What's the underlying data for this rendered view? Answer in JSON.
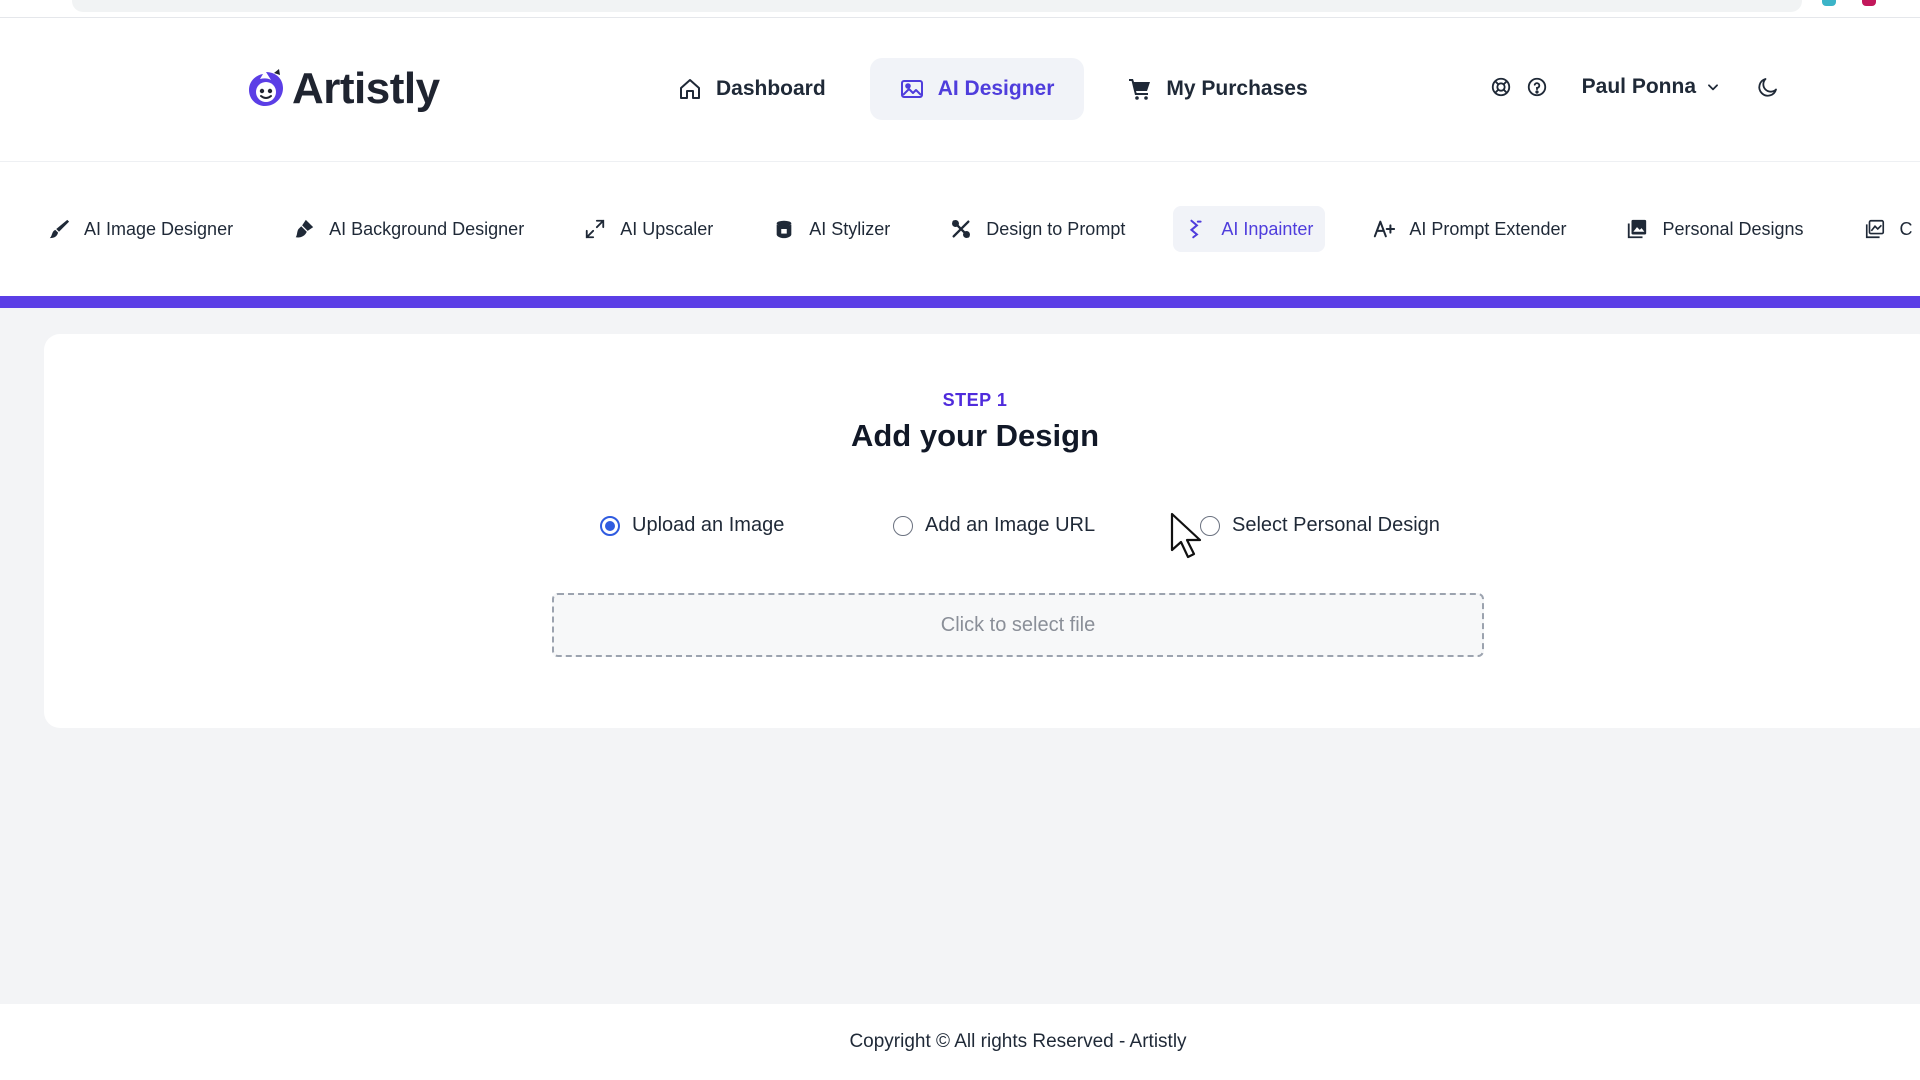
{
  "brand": {
    "name": "Artistly",
    "accent_color": "#5b3ee6",
    "active_text_color": "#4f3ddc",
    "logo_icon": "palette-face-icon"
  },
  "main_nav": [
    {
      "label": "Dashboard",
      "icon": "home-icon",
      "active": false
    },
    {
      "label": "AI Designer",
      "icon": "image-icon",
      "active": true
    },
    {
      "label": "My Purchases",
      "icon": "cart-icon",
      "active": false
    }
  ],
  "header": {
    "support_icon": "lifebuoy-icon",
    "help_icon": "question-icon",
    "user_name": "Paul Ponna",
    "theme_icon": "moon-icon"
  },
  "sub_nav": [
    {
      "label": "AI Image Designer",
      "icon": "brush-icon",
      "active": false
    },
    {
      "label": "AI Background Designer",
      "icon": "paint-drop-icon",
      "active": false
    },
    {
      "label": "AI Upscaler",
      "icon": "expand-icon",
      "active": false
    },
    {
      "label": "AI Stylizer",
      "icon": "paint-bucket-icon",
      "active": false
    },
    {
      "label": "Design to Prompt",
      "icon": "tools-icon",
      "active": false
    },
    {
      "label": "AI Inpainter",
      "icon": "wand-icon",
      "active": true
    },
    {
      "label": "AI Prompt Extender",
      "icon": "text-plus-icon",
      "active": false
    },
    {
      "label": "Personal Designs",
      "icon": "gallery-icon",
      "active": false
    },
    {
      "label": "C",
      "icon": "image-stack-icon",
      "active": false
    }
  ],
  "step": {
    "label": "STEP 1",
    "title": "Add your Design"
  },
  "source_options": [
    {
      "label": "Upload an Image",
      "selected": true
    },
    {
      "label": "Add an Image URL",
      "selected": false
    },
    {
      "label": "Select Personal Design",
      "selected": false
    }
  ],
  "file_input": {
    "placeholder": "Click to select file"
  },
  "footer": {
    "copyright": "Copyright © All rights Reserved - Artistly"
  }
}
